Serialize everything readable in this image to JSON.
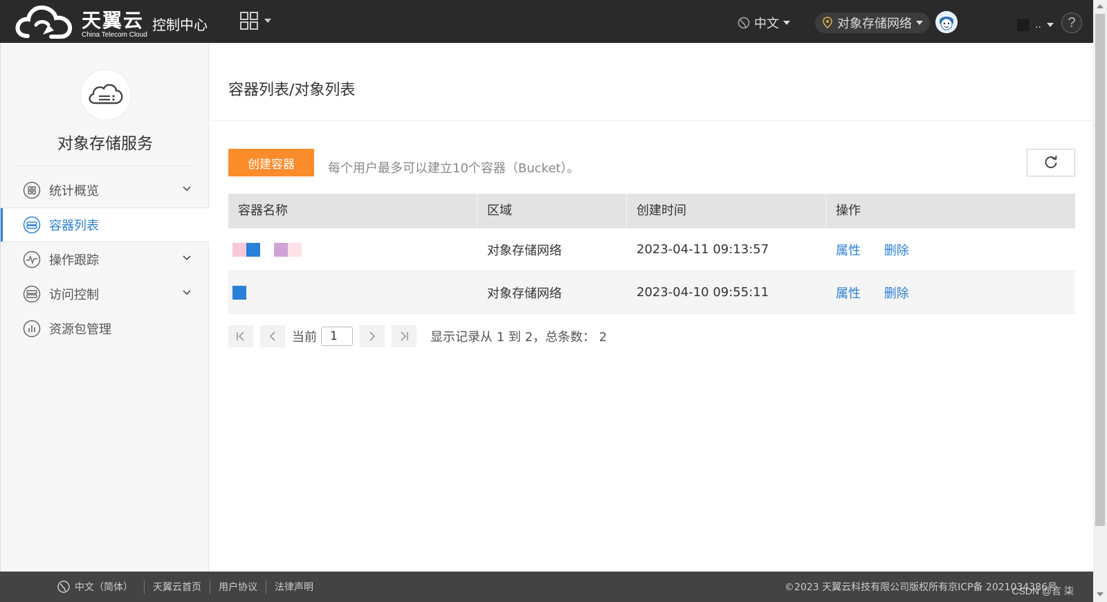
{
  "header": {
    "brand_main": "天翼云",
    "brand_sub": "China Telecom Cloud",
    "brand_console": "控制中心",
    "language": "中文",
    "region": "对象存储网络",
    "user_name": "..",
    "help": "?"
  },
  "sidebar": {
    "service_title": "对象存储服务",
    "items": [
      {
        "label": "统计概览",
        "icon": "dashboard-icon",
        "expandable": true,
        "active": false
      },
      {
        "label": "容器列表",
        "icon": "bucket-icon",
        "expandable": false,
        "active": true
      },
      {
        "label": "操作跟踪",
        "icon": "trace-icon",
        "expandable": true,
        "active": false
      },
      {
        "label": "访问控制",
        "icon": "access-icon",
        "expandable": true,
        "active": false
      },
      {
        "label": "资源包管理",
        "icon": "package-icon",
        "expandable": false,
        "active": false
      }
    ]
  },
  "main": {
    "title": "容器列表/对象列表",
    "create_button": "创建容器",
    "hint": "每个用户最多可以建立10个容器（Bucket）。",
    "table": {
      "headers": [
        "容器名称",
        "区域",
        "创建时间",
        "操作"
      ],
      "rows": [
        {
          "name_swatches": [
            "#f9c9d9",
            "#2a7fd6",
            "#ffffff",
            "#cfa3d8",
            "#fde0e8"
          ],
          "region": "对象存储网络",
          "created": "2023-04-11 09:13:57",
          "actions": [
            "属性",
            "删除"
          ]
        },
        {
          "name_swatches": [
            "#2a7fd6"
          ],
          "region": "对象存储网络",
          "created": "2023-04-10 09:55:11",
          "actions": [
            "属性",
            "删除"
          ]
        }
      ]
    },
    "pager": {
      "current_label": "当前",
      "current_page": "1",
      "info": "显示记录从 1 到 2，总条数： 2"
    }
  },
  "footer": {
    "language": "中文（简体）",
    "links": [
      "天翼云首页",
      "用户协议",
      "法律声明"
    ],
    "copyright": "©2023 天翼云科技有限公司版权所有京ICP备 2021034386号",
    "watermark": "CSDN @言 柒"
  },
  "colors": {
    "accent_blue": "#2a7fd6",
    "create_orange": "#fb8c2c",
    "topbar": "#2a2a2a",
    "footer": "#434343"
  }
}
